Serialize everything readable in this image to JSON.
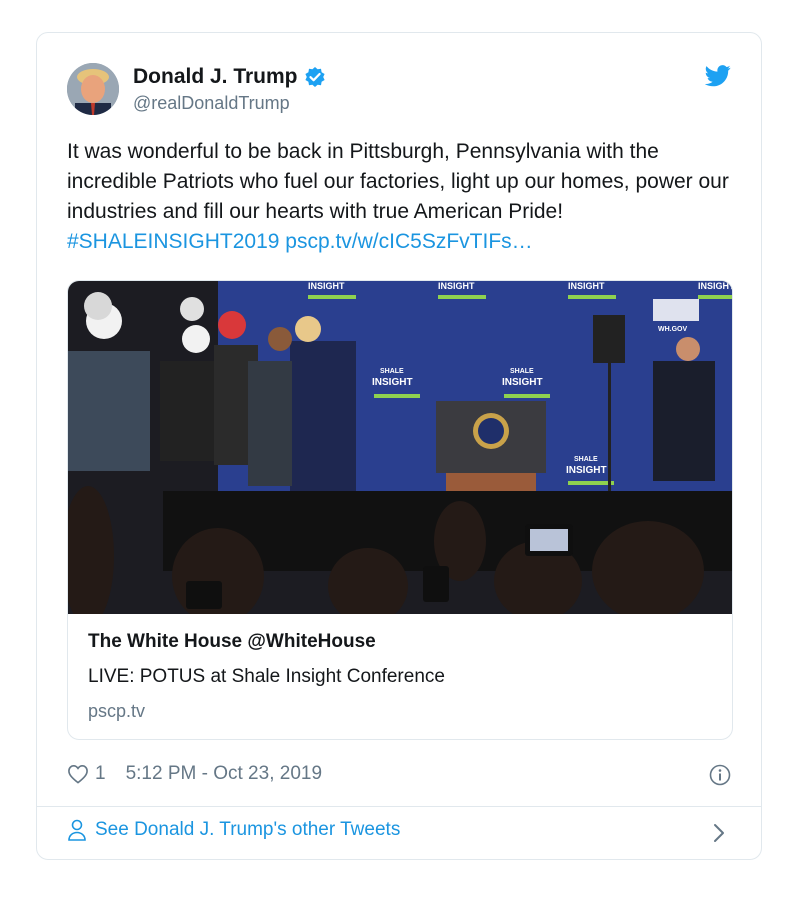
{
  "tweet": {
    "author_name": "Donald J. Trump",
    "handle": "@realDonaldTrump",
    "text": "It was wonderful to be back in Pittsburgh, Pennsylvania with the incredible Patriots who fuel our factories, light up our homes, power our industries and fill our hearts with true American Pride!",
    "hashtag": "#SHALEINSIGHT2019",
    "link": "pscp.tv/w/cIC5SzFvTIFs…",
    "likes": "1",
    "timestamp": "5:12 PM - Oct 23, 2019",
    "footer_link": "See Donald J. Trump's other Tweets"
  },
  "link_card": {
    "title": "The White House @WhiteHouse",
    "description": "LIVE: POTUS at Shale Insight Conference",
    "domain": "pscp.tv",
    "backdrop_text": "INSIGHT",
    "backdrop_small": "SHALE",
    "wh_gov": "WH.GOV"
  },
  "icons": [
    "verified-badge-icon",
    "twitter-bird-icon",
    "heart-icon",
    "info-icon",
    "person-icon",
    "chevron-right-icon"
  ],
  "colors": {
    "link": "#1b95e0",
    "secondary_text": "#657786",
    "border": "#e1e8ed",
    "stage_blue": "#2a3f8f"
  }
}
